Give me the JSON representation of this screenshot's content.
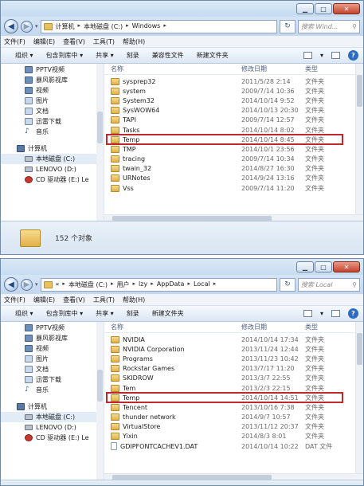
{
  "windows": [
    {
      "breadcrumb": [
        "计算机",
        "本地磁盘 (C:)",
        "Windows"
      ],
      "search_placeholder": "搜索 Wind...",
      "menu": [
        "文件(F)",
        "编辑(E)",
        "查看(V)",
        "工具(T)",
        "帮助(H)"
      ],
      "toolbar": [
        "组织 ▾",
        "包含到库中 ▾",
        "共享 ▾",
        "刻录",
        "兼容性文件",
        "新建文件夹"
      ],
      "nav": [
        {
          "label": "PPTV视频",
          "icon": "video-icon"
        },
        {
          "label": "暴风影视库",
          "icon": "video-library-icon"
        },
        {
          "label": "视频",
          "icon": "video-icon"
        },
        {
          "label": "图片",
          "icon": "picture-icon"
        },
        {
          "label": "文档",
          "icon": "document-icon"
        },
        {
          "label": "迅雷下载",
          "icon": "download-icon"
        },
        {
          "label": "音乐",
          "icon": "music-icon"
        },
        {
          "label": "计算机",
          "icon": "computer-icon",
          "group": true
        },
        {
          "label": "本地磁盘 (C:)",
          "icon": "drive-icon",
          "selected": true
        },
        {
          "label": "LENOVO (D:)",
          "icon": "drive-icon"
        },
        {
          "label": "CD 驱动器 (E:) Le",
          "icon": "cd-drive-icon"
        }
      ],
      "columns": [
        "名称",
        "修改日期",
        "类型"
      ],
      "rows": [
        {
          "name": "sysprep32",
          "date": "2011/5/28 2:14",
          "type": "文件夹"
        },
        {
          "name": "system",
          "date": "2009/7/14 10:36",
          "type": "文件夹"
        },
        {
          "name": "System32",
          "date": "2014/10/14 9:52",
          "type": "文件夹"
        },
        {
          "name": "SysWOW64",
          "date": "2014/10/13 20:30",
          "type": "文件夹"
        },
        {
          "name": "TAPI",
          "date": "2009/7/14 12:57",
          "type": "文件夹"
        },
        {
          "name": "Tasks",
          "date": "2014/10/14 8:02",
          "type": "文件夹"
        },
        {
          "name": "Temp",
          "date": "2014/10/14 8:45",
          "type": "文件夹",
          "highlight": true
        },
        {
          "name": "TMP",
          "date": "2014/10/1 23:56",
          "type": "文件夹"
        },
        {
          "name": "tracing",
          "date": "2009/7/14 10:34",
          "type": "文件夹"
        },
        {
          "name": "twain_32",
          "date": "2014/8/27 16:30",
          "type": "文件夹"
        },
        {
          "name": "URNotes",
          "date": "2014/9/24 13:16",
          "type": "文件夹"
        },
        {
          "name": "Vss",
          "date": "2009/7/14 11:20",
          "type": "文件夹"
        }
      ],
      "status_text": "152 个对象"
    },
    {
      "breadcrumb": [
        "«",
        "本地磁盘 (C:)",
        "用户",
        "lzy",
        "AppData",
        "Local"
      ],
      "search_placeholder": "搜索 Local",
      "menu": [
        "文件(F)",
        "编辑(E)",
        "查看(V)",
        "工具(T)",
        "帮助(H)"
      ],
      "toolbar": [
        "组织 ▾",
        "包含到库中 ▾",
        "共享 ▾",
        "刻录",
        "新建文件夹"
      ],
      "nav": [
        {
          "label": "PPTV视频",
          "icon": "video-icon"
        },
        {
          "label": "暴风影视库",
          "icon": "video-library-icon"
        },
        {
          "label": "视频",
          "icon": "video-icon"
        },
        {
          "label": "图片",
          "icon": "picture-icon"
        },
        {
          "label": "文档",
          "icon": "document-icon"
        },
        {
          "label": "迅雷下载",
          "icon": "download-icon"
        },
        {
          "label": "音乐",
          "icon": "music-icon"
        },
        {
          "label": "计算机",
          "icon": "computer-icon",
          "group": true
        },
        {
          "label": "本地磁盘 (C:)",
          "icon": "drive-icon",
          "selected": true
        },
        {
          "label": "LENOVO (D:)",
          "icon": "drive-icon"
        },
        {
          "label": "CD 驱动器 (E:) Le",
          "icon": "cd-drive-icon"
        }
      ],
      "columns": [
        "名称",
        "修改日期",
        "类型"
      ],
      "rows": [
        {
          "name": "NVIDIA",
          "date": "2014/10/14 17:34",
          "type": "文件夹"
        },
        {
          "name": "NVIDIA Corporation",
          "date": "2013/11/24 12:44",
          "type": "文件夹"
        },
        {
          "name": "Programs",
          "date": "2013/11/23 10:42",
          "type": "文件夹"
        },
        {
          "name": "Rockstar Games",
          "date": "2013/7/17 11:20",
          "type": "文件夹"
        },
        {
          "name": "SKIDROW",
          "date": "2013/3/7 22:55",
          "type": "文件夹"
        },
        {
          "name": "Tem",
          "date": "2013/2/3 22:15",
          "type": "文件夹"
        },
        {
          "name": "Temp",
          "date": "2014/10/14 14:51",
          "type": "文件夹",
          "highlight": true
        },
        {
          "name": "Tencent",
          "date": "2013/10/16 7:38",
          "type": "文件夹"
        },
        {
          "name": "thunder network",
          "date": "2014/9/7 10:57",
          "type": "文件夹"
        },
        {
          "name": "VirtualStore",
          "date": "2013/11/12 20:37",
          "type": "文件夹"
        },
        {
          "name": "Yixin",
          "date": "2014/8/3 8:01",
          "type": "文件夹"
        },
        {
          "name": "GDIPFONTCACHEV1.DAT",
          "date": "2014/10/14 10:22",
          "type": "DAT 文件",
          "file": true
        }
      ],
      "status_text": ""
    }
  ],
  "colors": {
    "highlight": "#c0282d",
    "folder": "#e0b04a",
    "titlebar": "#c7dcf1"
  }
}
